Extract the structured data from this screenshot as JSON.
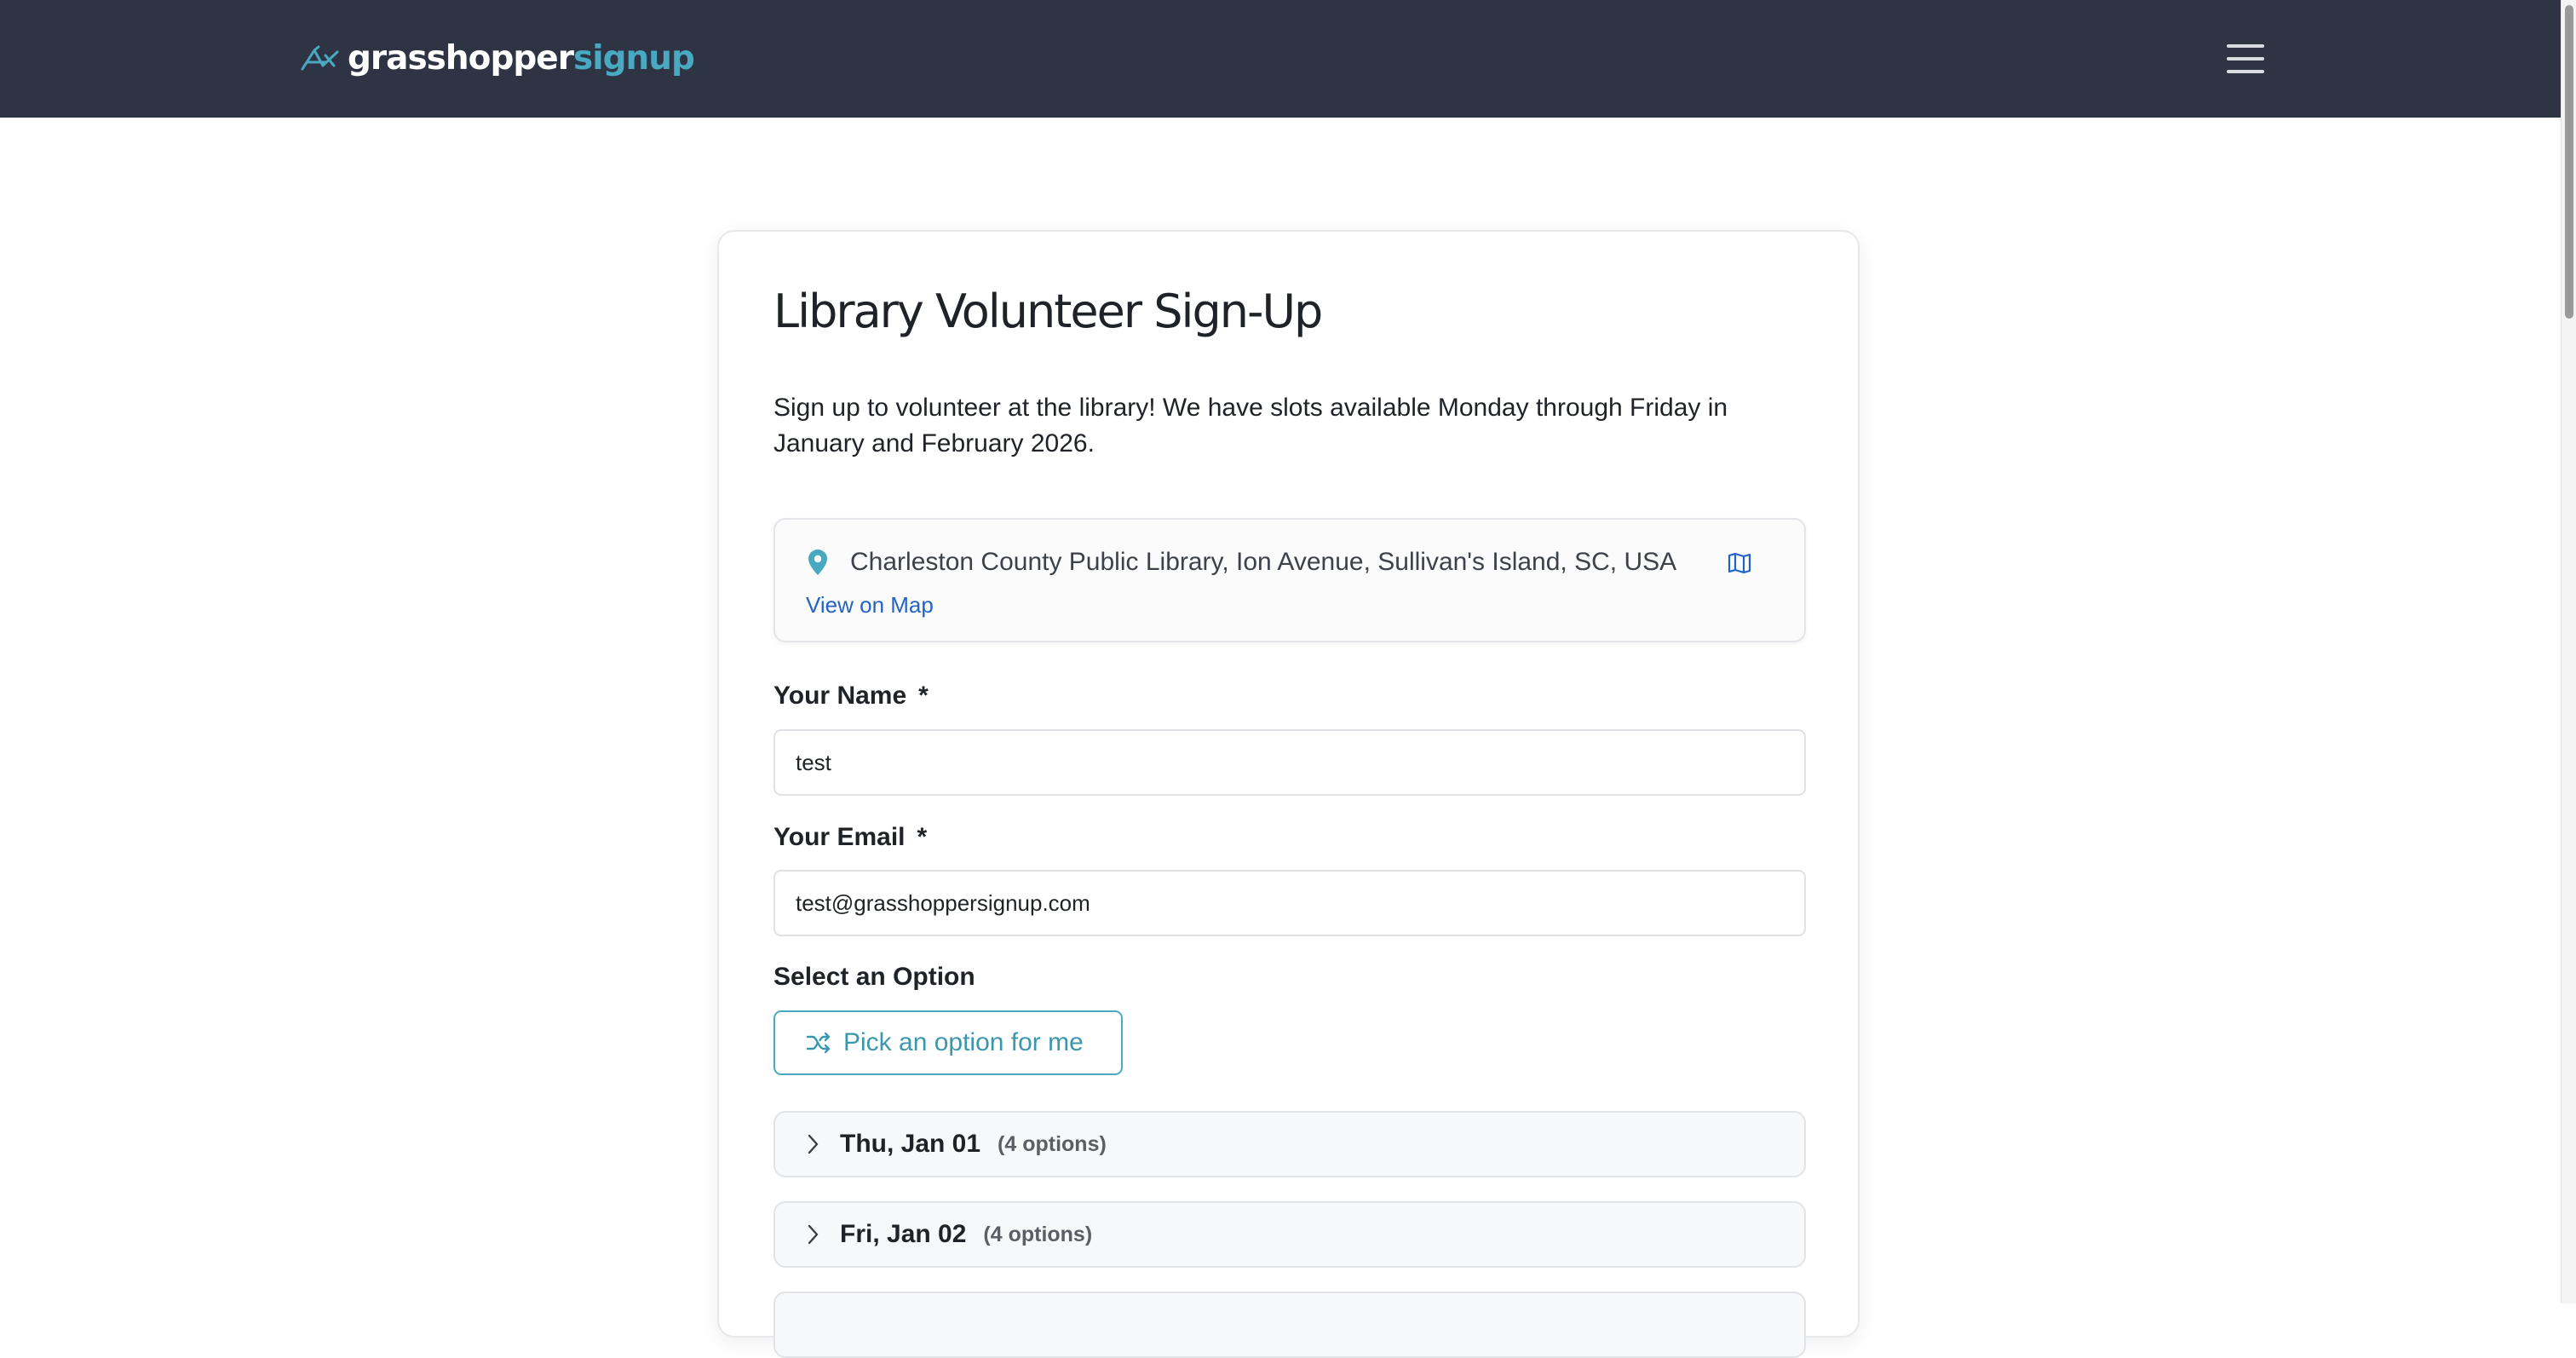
{
  "header": {
    "brand_part1": "grasshopper",
    "brand_part2": "signup",
    "menu_icon": "hamburger-menu-icon",
    "logo_icon": "grasshopper-logo-icon"
  },
  "colors": {
    "navbar": "#2e3444",
    "accent": "#49a9c0",
    "link": "#2363c6"
  },
  "event": {
    "title": "Library Volunteer Sign-Up",
    "description": "Sign up to volunteer at the library! We have slots available Monday through Friday in January and February 2026.",
    "location": {
      "address": "Charleston County Public Library, Ion Avenue, Sullivan's Island, SC, USA",
      "map_link": "View on Map",
      "pin_icon": "map-pin-icon",
      "map_icon": "map-icon"
    }
  },
  "form": {
    "name": {
      "label": "Your Name",
      "required_marker": "*",
      "value": "test"
    },
    "email": {
      "label": "Your Email",
      "required_marker": "*",
      "value": "test@grasshoppersignup.com"
    },
    "select_label": "Select an Option",
    "pick_button": "Pick an option for me",
    "dates": [
      {
        "label": "Thu, Jan 01",
        "count": "(4 options)"
      },
      {
        "label": "Fri, Jan 02",
        "count": "(4 options)"
      }
    ]
  }
}
